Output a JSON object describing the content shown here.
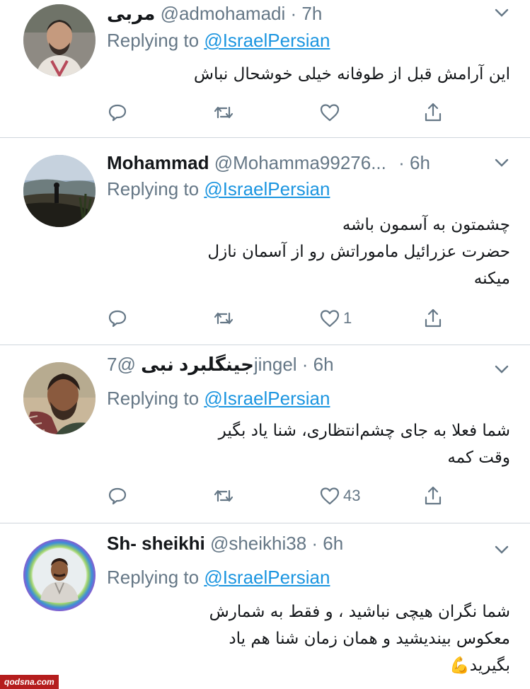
{
  "tweets": [
    {
      "name": "مربی",
      "handle": "@admohamadi",
      "time": "· 7h",
      "replying_prefix": "Replying to ",
      "replying_to": "@IsraelPersian",
      "lines": [
        "این آرامش قبل از طوفانه خیلی خوشحال نباش"
      ],
      "likes": ""
    },
    {
      "name": "Mohammad",
      "handle": "@Mohamma99276...",
      "time": "· 6h",
      "replying_prefix": "Replying to ",
      "replying_to": "@IsraelPersian",
      "lines": [
        "چشمتون به آسمون باشه",
        "حضرت عزرائیل ماموراتش رو از آسمان نازل",
        "میکنه"
      ],
      "likes": "1"
    },
    {
      "name": "جینگلبرد نبی",
      "handle": "@7jingel",
      "time": "· 6h",
      "replying_prefix": "Replying to ",
      "replying_to": "@IsraelPersian",
      "lines": [
        "شما فعلا به جای چشم‌انتظاری، شنا یاد بگیر",
        "وقت کمه"
      ],
      "likes": "43"
    },
    {
      "name": "Sh- sheikhi",
      "handle": "@sheikhi38",
      "time": "· 6h",
      "replying_prefix": "Replying to ",
      "replying_to": "@IsraelPersian",
      "lines": [
        "شما نگران هیچی نباشید ، و فقط به شمارش",
        "معکوس بیندیشید و همان زمان شنا هم یاد",
        "بگیرید💪"
      ],
      "likes": ""
    }
  ],
  "icons": {
    "reply": "reply-icon",
    "retweet": "retweet-icon",
    "like": "heart-icon",
    "share": "share-icon",
    "more": "chevron-down-icon"
  },
  "colors": {
    "muted": "#657786",
    "link": "#1b95e0",
    "divider": "#cfd6dc",
    "watermark_bg": "#b51d1d"
  },
  "watermark": "qodsna.com"
}
